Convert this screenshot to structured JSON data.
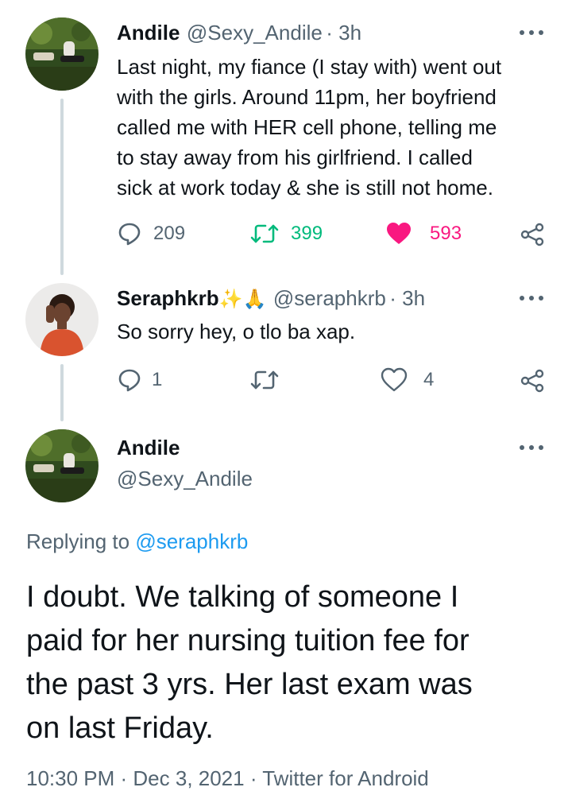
{
  "tweet1": {
    "name": "Andile",
    "handle": "@Sexy_Andile",
    "time": "· 3h",
    "text_lines": [
      "Last night, my fiance (I stay with) went out",
      "with the girls. Around 11pm, her boyfriend",
      "called me with HER cell phone, telling me",
      "to stay away from his girlfriend. I called",
      "sick at work today & she is still not home."
    ],
    "replies": "209",
    "retweets": "399",
    "likes": "593"
  },
  "tweet2": {
    "name": "Seraphkrb",
    "name_emojis": "✨🙏",
    "handle": "@seraphkrb",
    "time": "· 3h",
    "text": "So sorry hey, o tlo ba xap.",
    "replies": "1",
    "likes": "4"
  },
  "main_tweet": {
    "name": "Andile",
    "handle": "@Sexy_Andile",
    "replying_prefix": "Replying to",
    "replying_handle": "@seraphkrb",
    "text_lines": [
      "I doubt. We talking of someone I",
      "paid for her nursing tuition fee for",
      "the past 3 yrs. Her last exam was",
      "on last Friday."
    ],
    "footer": "10:30 PM · Dec 3, 2021 · Twitter for Android"
  },
  "colors": {
    "retweet_active": "#00ba7c",
    "like_active": "#f91880",
    "link": "#1d9bf0",
    "secondary": "#536471",
    "thread_line": "#cfd9de"
  }
}
